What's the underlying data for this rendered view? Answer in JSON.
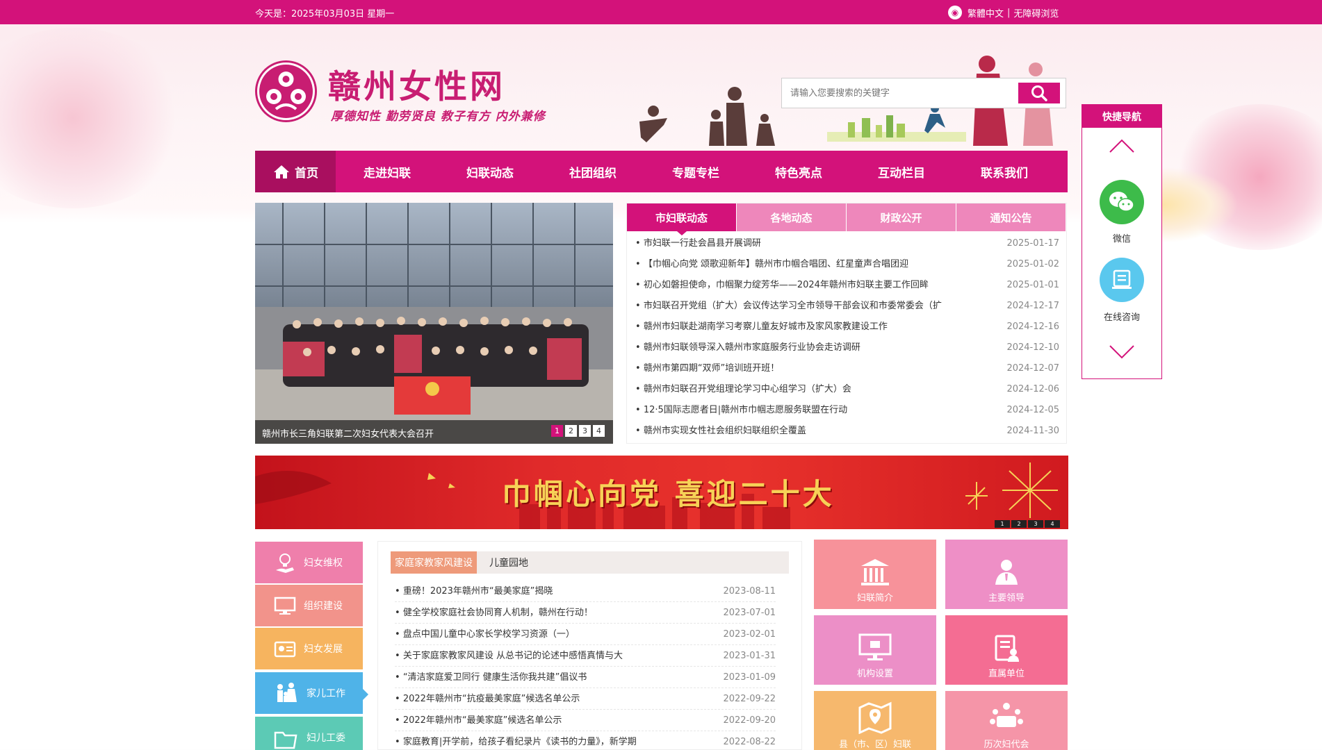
{
  "topbar": {
    "date": "今天是：2025年03月03日 星期一",
    "trad": "繁體中文",
    "separator": "|",
    "access": "无障碍浏览"
  },
  "header": {
    "site_name": "赣州女性网",
    "slogan": "厚德知性  勤劳贤良  教子有方  内外兼修",
    "search_placeholder": "请输入您要搜索的关键字"
  },
  "nav": [
    "首页",
    "走进妇联",
    "妇联动态",
    "社团组织",
    "专题专栏",
    "特色亮点",
    "互动栏目",
    "联系我们"
  ],
  "slider": {
    "caption": "赣州市长三角妇联第二次妇女代表大会召开",
    "pages": [
      "1",
      "2",
      "3",
      "4"
    ]
  },
  "news": {
    "tabs": [
      "市妇联动态",
      "各地动态",
      "财政公开",
      "通知公告"
    ],
    "items": [
      {
        "title": "市妇联一行赴会昌县开展调研",
        "date": "2025-01-17"
      },
      {
        "title": "【巾帼心向党 颂歌迎新年】赣州市巾帼合唱团、红星童声合唱团迎",
        "date": "2025-01-02"
      },
      {
        "title": "初心如磐担使命，巾帼聚力绽芳华——2024年赣州市妇联主要工作回眸",
        "date": "2025-01-01"
      },
      {
        "title": "市妇联召开党组（扩大）会议传达学习全市领导干部会议和市委常委会（扩",
        "date": "2024-12-17"
      },
      {
        "title": "赣州市妇联赴湖南学习考察儿童友好城市及家风家教建设工作",
        "date": "2024-12-16"
      },
      {
        "title": "赣州市妇联领导深入赣州市家庭服务行业协会走访调研",
        "date": "2024-12-10"
      },
      {
        "title": "赣州市第四期“双师”培训班开班！",
        "date": "2024-12-07"
      },
      {
        "title": "赣州市妇联召开党组理论学习中心组学习（扩大）会",
        "date": "2024-12-06"
      },
      {
        "title": "12·5国际志愿者日|赣州市巾帼志愿服务联盟在行动",
        "date": "2024-12-05"
      },
      {
        "title": "赣州市实现女性社会组织妇联组织全覆盖",
        "date": "2024-11-30"
      }
    ]
  },
  "banner": {
    "text": "巾帼心向党 喜迎二十大",
    "pages": [
      "1",
      "2",
      "3",
      "4"
    ]
  },
  "side_menu": [
    {
      "label": "妇女维权",
      "color": "#ef7fab",
      "icon": "lightbulb-hand-icon"
    },
    {
      "label": "组织建设",
      "color": "#f2938b",
      "icon": "monitor-icon"
    },
    {
      "label": "妇女发展",
      "color": "#f6b45f",
      "icon": "id-card-icon"
    },
    {
      "label": "家儿工作",
      "color": "#4fb3e8",
      "icon": "family-icon"
    },
    {
      "label": "妇儿工委",
      "color": "#5ccab5",
      "icon": "folder-icon"
    }
  ],
  "family": {
    "tabs": [
      "家庭家教家风建设",
      "儿童园地"
    ],
    "items": [
      {
        "title": "重磅！2023年赣州市“最美家庭”揭晓",
        "date": "2023-08-11"
      },
      {
        "title": "健全学校家庭社会协同育人机制，赣州在行动！",
        "date": "2023-07-01"
      },
      {
        "title": "盘点中国儿童中心家长学校学习资源（一）",
        "date": "2023-02-01"
      },
      {
        "title": "关于家庭家教家风建设 从总书记的论述中感悟真情与大",
        "date": "2023-01-31"
      },
      {
        "title": "“清洁家庭爱卫同行 健康生活你我共建”倡议书",
        "date": "2023-01-09"
      },
      {
        "title": "2022年赣州市“抗疫最美家庭”候选名单公示",
        "date": "2022-09-22"
      },
      {
        "title": "2022年赣州市“最美家庭”候选名单公示",
        "date": "2022-09-20"
      },
      {
        "title": "家庭教育|开学前，给孩子看纪录片《读书的力量》，新学期",
        "date": "2022-08-22"
      }
    ]
  },
  "tiles": [
    {
      "label": "妇联简介",
      "color": "#f7929a",
      "icon": "building-icon"
    },
    {
      "label": "主要领导",
      "color": "#ee8fc6",
      "icon": "leader-icon"
    },
    {
      "label": "机构设置",
      "color": "#ec8fc7",
      "icon": "monitor-org-icon"
    },
    {
      "label": "直属单位",
      "color": "#f46d93",
      "icon": "clipboard-user-icon"
    },
    {
      "label": "县（市、区）妇联",
      "color": "#f6b86d",
      "icon": "map-pin-icon"
    },
    {
      "label": "历次妇代会",
      "color": "#f595a8",
      "icon": "meeting-icon"
    }
  ],
  "quicknav": {
    "title": "快捷导航",
    "wechat": "微信",
    "consult": "在线咨询"
  },
  "colors": {
    "brand": "#d3127a",
    "brand_dark": "#a90f5f",
    "tab_light": "#ee87bb"
  }
}
